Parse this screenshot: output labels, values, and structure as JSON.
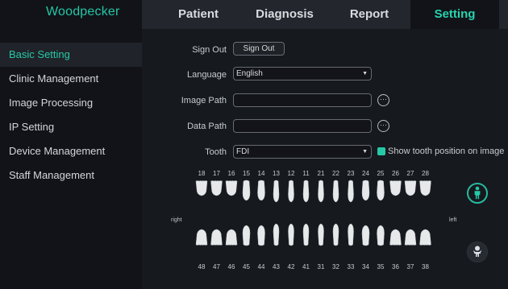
{
  "brand": {
    "name": "Woodpecker"
  },
  "nav": {
    "tabs": [
      {
        "label": "Patient"
      },
      {
        "label": "Diagnosis"
      },
      {
        "label": "Report"
      },
      {
        "label": "Setting"
      }
    ]
  },
  "sidebar": {
    "items": [
      {
        "label": "Basic Setting",
        "active": true
      },
      {
        "label": "Clinic Management"
      },
      {
        "label": "Image Processing"
      },
      {
        "label": "IP Setting"
      },
      {
        "label": "Device Management"
      },
      {
        "label": "Staff Management"
      }
    ]
  },
  "settings": {
    "sign_out_label": "Sign Out",
    "sign_out_button": "Sign Out",
    "language_label": "Language",
    "language_value": "English",
    "image_path_label": "Image Path",
    "image_path_value": "",
    "data_path_label": "Data Path",
    "data_path_value": "",
    "tooth_label": "Tooth",
    "tooth_value": "FDI",
    "show_tooth_position": true,
    "show_tooth_position_label": "Show tooth position on image"
  },
  "tooth_chart": {
    "upper_numbers": [
      "18",
      "17",
      "16",
      "15",
      "14",
      "13",
      "12",
      "11",
      "21",
      "22",
      "23",
      "24",
      "25",
      "26",
      "27",
      "28"
    ],
    "lower_numbers": [
      "48",
      "47",
      "46",
      "45",
      "44",
      "43",
      "42",
      "41",
      "31",
      "32",
      "33",
      "34",
      "35",
      "36",
      "37",
      "38"
    ],
    "right_label": "right",
    "left_label": "left"
  },
  "colors": {
    "accent": "#26c9a6",
    "topbar": "#23262c",
    "sidebar_bg": "#111318",
    "main_bg": "#16191e"
  },
  "icons": {
    "adult": "adult-icon",
    "child": "child-icon",
    "browse": "ellipsis-icon",
    "dropdown": "chevron-down-icon"
  }
}
